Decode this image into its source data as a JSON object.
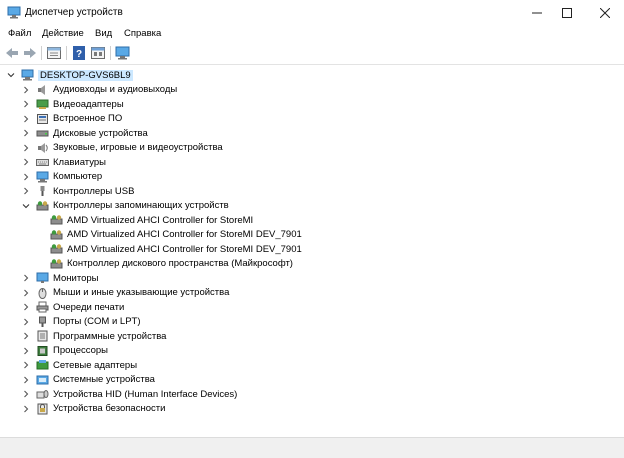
{
  "window": {
    "title": "Диспетчер устройств"
  },
  "menu": [
    "Файл",
    "Действие",
    "Вид",
    "Справка"
  ],
  "tree": {
    "root": "DESKTOP-GVS6BL9",
    "items": [
      {
        "label": "Аудиовходы и аудиовыходы",
        "icon": "speaker-icon"
      },
      {
        "label": "Видеоадаптеры",
        "icon": "display-adapter-icon"
      },
      {
        "label": "Встроенное ПО",
        "icon": "firmware-icon"
      },
      {
        "label": "Дисковые устройства",
        "icon": "disk-drive-icon"
      },
      {
        "label": "Звуковые, игровые и видеоустройства",
        "icon": "sound-icon"
      },
      {
        "label": "Клавиатуры",
        "icon": "keyboard-icon"
      },
      {
        "label": "Компьютер",
        "icon": "computer-icon"
      },
      {
        "label": "Контроллеры USB",
        "icon": "usb-icon"
      },
      {
        "label": "Контроллеры запоминающих устройств",
        "icon": "storage-controller-icon",
        "expanded": true,
        "children": [
          {
            "label": "AMD Virtualized AHCI Controller for StoreMI"
          },
          {
            "label": "AMD Virtualized AHCI Controller for StoreMI DEV_7901"
          },
          {
            "label": "AMD Virtualized AHCI Controller for StoreMI DEV_7901"
          },
          {
            "label": "Контроллер дискового пространства (Майкрософт)"
          }
        ]
      },
      {
        "label": "Мониторы",
        "icon": "monitor-icon"
      },
      {
        "label": "Мыши и иные указывающие устройства",
        "icon": "mouse-icon"
      },
      {
        "label": "Очереди печати",
        "icon": "printer-icon"
      },
      {
        "label": "Порты (COM и LPT)",
        "icon": "port-icon"
      },
      {
        "label": "Программные устройства",
        "icon": "software-device-icon"
      },
      {
        "label": "Процессоры",
        "icon": "processor-icon"
      },
      {
        "label": "Сетевые адаптеры",
        "icon": "network-adapter-icon"
      },
      {
        "label": "Системные устройства",
        "icon": "system-device-icon"
      },
      {
        "label": "Устройства HID (Human Interface Devices)",
        "icon": "hid-icon"
      },
      {
        "label": "Устройства безопасности",
        "icon": "security-device-icon"
      }
    ]
  }
}
